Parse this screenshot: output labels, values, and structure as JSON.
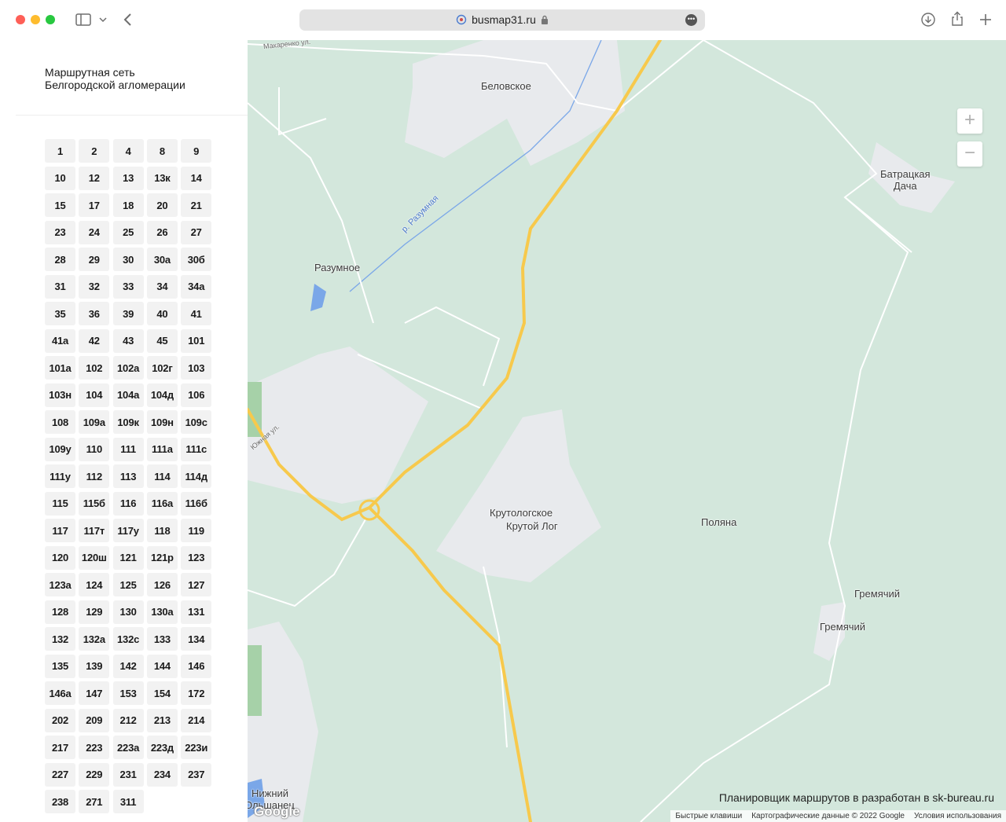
{
  "browser": {
    "url": "busmap31.ru"
  },
  "sidebar": {
    "title_line1": "Маршрутная сеть",
    "title_line2": "Белгородской агломерации",
    "routes": [
      "1",
      "2",
      "4",
      "8",
      "9",
      "10",
      "12",
      "13",
      "13к",
      "14",
      "15",
      "17",
      "18",
      "20",
      "21",
      "23",
      "24",
      "25",
      "26",
      "27",
      "28",
      "29",
      "30",
      "30а",
      "30б",
      "31",
      "32",
      "33",
      "34",
      "34а",
      "35",
      "36",
      "39",
      "40",
      "41",
      "41а",
      "42",
      "43",
      "45",
      "101",
      "101а",
      "102",
      "102а",
      "102г",
      "103",
      "103н",
      "104",
      "104а",
      "104д",
      "106",
      "108",
      "109а",
      "109к",
      "109н",
      "109с",
      "109у",
      "110",
      "111",
      "111а",
      "111с",
      "111у",
      "112",
      "113",
      "114",
      "114д",
      "115",
      "115б",
      "116",
      "116а",
      "116б",
      "117",
      "117т",
      "117у",
      "118",
      "119",
      "120",
      "120ш",
      "121",
      "121р",
      "123",
      "123а",
      "124",
      "125",
      "126",
      "127",
      "128",
      "129",
      "130",
      "130а",
      "131",
      "132",
      "132а",
      "132с",
      "133",
      "134",
      "135",
      "139",
      "142",
      "144",
      "146",
      "146а",
      "147",
      "153",
      "154",
      "172",
      "202",
      "209",
      "212",
      "213",
      "214",
      "217",
      "223",
      "223а",
      "223д",
      "223и",
      "227",
      "229",
      "231",
      "234",
      "237",
      "238",
      "271",
      "311"
    ]
  },
  "map": {
    "labels": {
      "belovskoe": "Беловское",
      "batratskaya_1": "Батрацкая",
      "batratskaya_2": "Дача",
      "razumnoe": "Разумное",
      "river": "р. Разумная",
      "krutologskoe": "Крутологское",
      "krutoy_log": "Крутой Лог",
      "polyana": "Поляна",
      "gremyachiy_1": "Гремячий",
      "gremyachiy_2": "Гремячий",
      "nizhny_1": "Нижний",
      "nizhny_2": "Ольшанец",
      "street_top": "Макаренко ул.",
      "street_left": "Южная ул."
    },
    "zoom_in": "+",
    "zoom_out": "−",
    "promo": "Планировщик маршрутов в разработан в sk-bureau.ru",
    "attribution": {
      "shortcuts": "Быстрые клавиши",
      "map_data": "Картографические данные © 2022 Google",
      "terms": "Условия использования"
    },
    "logo": "Google"
  },
  "colors": {
    "map_background": "#d3e7dc",
    "urban_area": "#e8eaed",
    "highway": "#f7c94c",
    "water": "#7aa7e8",
    "route_button": "#f2f2f2"
  }
}
